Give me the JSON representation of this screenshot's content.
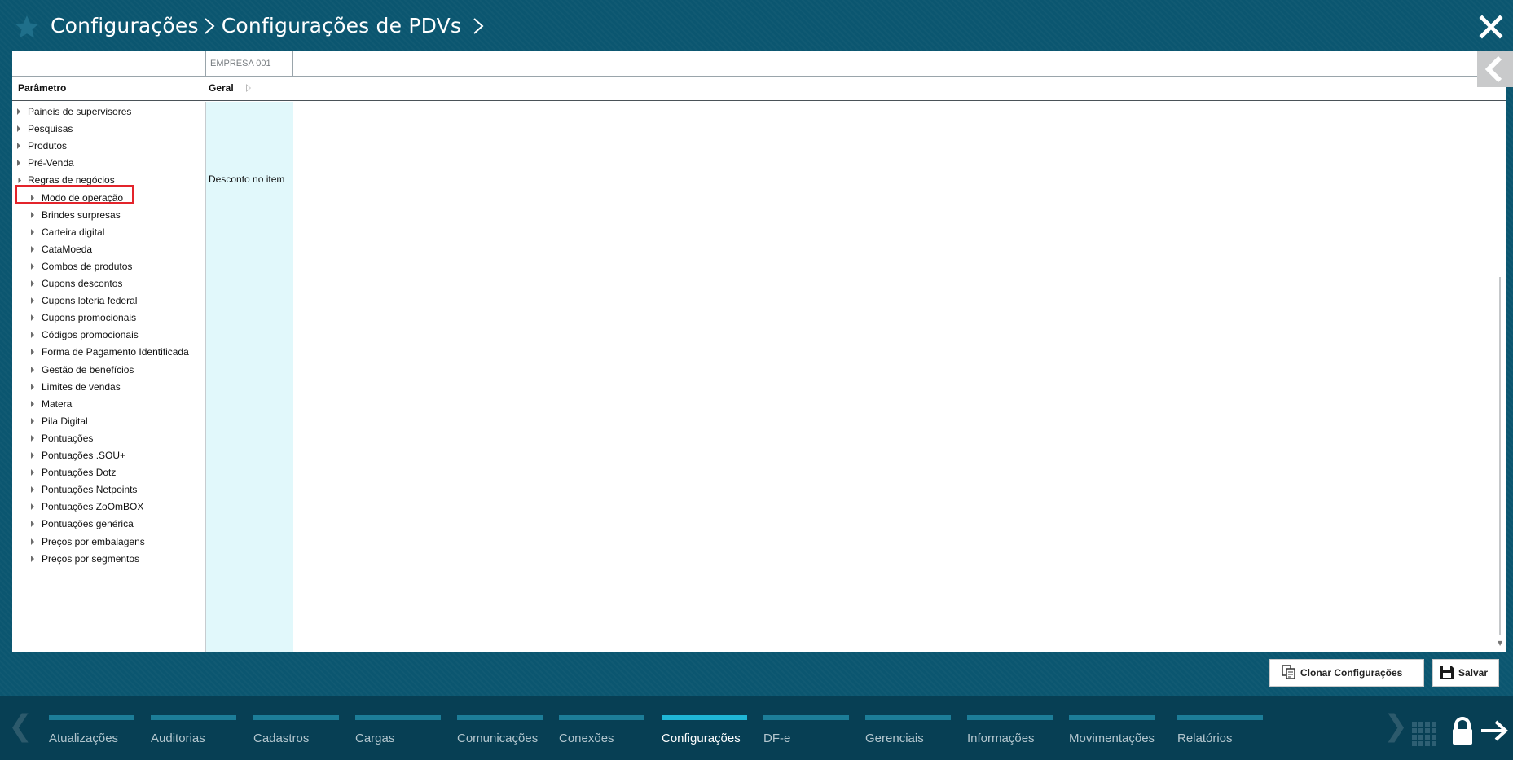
{
  "header": {
    "breadcrumbs": [
      "Configurações",
      "Configurações de PDVs"
    ]
  },
  "table": {
    "company_column": "EMPRESA 001",
    "param_header": "Parâmetro",
    "group_header": "Geral",
    "value_text": "Desconto no item"
  },
  "tree": [
    {
      "label": "Paineis de supervisores",
      "level": 0,
      "expanded": false
    },
    {
      "label": "Pesquisas",
      "level": 0,
      "expanded": false
    },
    {
      "label": "Produtos",
      "level": 0,
      "expanded": false
    },
    {
      "label": "Pré-Venda",
      "level": 0,
      "expanded": false
    },
    {
      "label": "Regras de negócios",
      "level": 0,
      "expanded": true
    },
    {
      "label": "Modo de operação",
      "level": 1,
      "expanded": false
    },
    {
      "label": "Brindes surpresas",
      "level": 1,
      "expanded": false
    },
    {
      "label": "Carteira digital",
      "level": 1,
      "expanded": false
    },
    {
      "label": "CataMoeda",
      "level": 1,
      "expanded": false
    },
    {
      "label": "Combos de produtos",
      "level": 1,
      "expanded": false
    },
    {
      "label": "Cupons descontos",
      "level": 1,
      "expanded": false
    },
    {
      "label": "Cupons loteria federal",
      "level": 1,
      "expanded": false
    },
    {
      "label": "Cupons promocionais",
      "level": 1,
      "expanded": false
    },
    {
      "label": "Códigos promocionais",
      "level": 1,
      "expanded": false
    },
    {
      "label": "Forma de Pagamento Identificada",
      "level": 1,
      "expanded": false
    },
    {
      "label": "Gestão de benefícios",
      "level": 1,
      "expanded": false
    },
    {
      "label": "Limites de vendas",
      "level": 1,
      "expanded": false
    },
    {
      "label": "Matera",
      "level": 1,
      "expanded": false
    },
    {
      "label": "Pila Digital",
      "level": 1,
      "expanded": false
    },
    {
      "label": "Pontuações",
      "level": 1,
      "expanded": false
    },
    {
      "label": "Pontuações .SOU+",
      "level": 1,
      "expanded": false
    },
    {
      "label": "Pontuações Dotz",
      "level": 1,
      "expanded": false
    },
    {
      "label": "Pontuações Netpoints",
      "level": 1,
      "expanded": false
    },
    {
      "label": "Pontuações ZoOmBOX",
      "level": 1,
      "expanded": false
    },
    {
      "label": "Pontuações genérica",
      "level": 1,
      "expanded": false
    },
    {
      "label": "Preços por embalagens",
      "level": 1,
      "expanded": false
    },
    {
      "label": "Preços por segmentos",
      "level": 1,
      "expanded": false
    }
  ],
  "actions": {
    "clone_label": "Clonar Configurações",
    "save_label": "Salvar"
  },
  "bottom_nav": {
    "active": "Configurações",
    "tabs": [
      "Atualizações",
      "Auditorias",
      "Cadastros",
      "Cargas",
      "Comunicações",
      "Conexões",
      "Configurações",
      "DF-e",
      "Gerenciais",
      "Informações",
      "Movimentações",
      "Relatórios"
    ]
  },
  "colors": {
    "background": "#0b5670",
    "bottom_bar": "#073f54",
    "highlight": "#e3242b",
    "value_column": "#e1f8fb",
    "active_tab": "#1fb6d6"
  },
  "icons": [
    "star-icon",
    "close-icon",
    "collapse-panel-icon",
    "clone-icon",
    "save-icon",
    "chevron-left-icon",
    "chevron-right-icon",
    "grid-icon",
    "lock-icon",
    "exit-arrow-icon"
  ]
}
